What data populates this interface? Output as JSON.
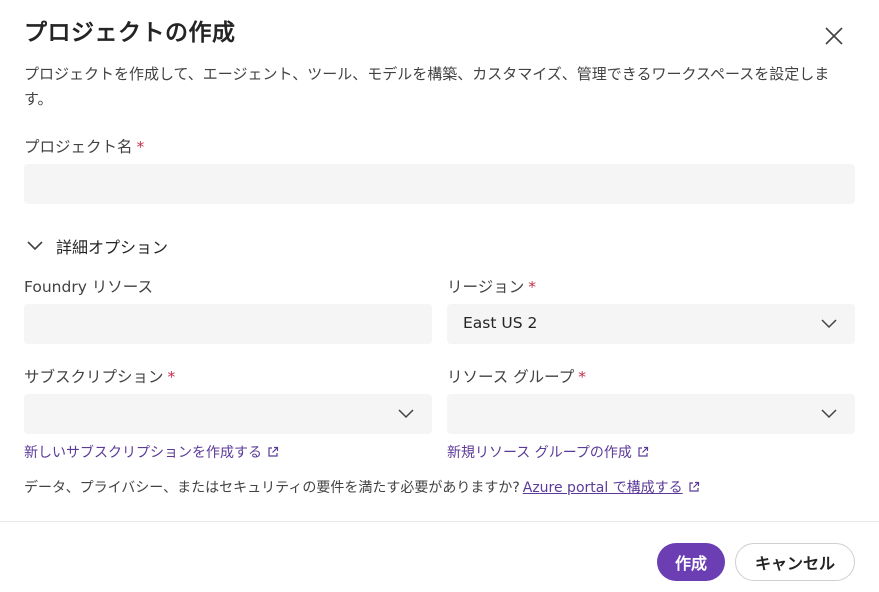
{
  "dialog": {
    "title": "プロジェクトの作成",
    "close_icon": "close-icon",
    "description": "プロジェクトを作成して、エージェント、ツール、モデルを構築、カスタマイズ、管理できるワークスペースを設定します。"
  },
  "project_name": {
    "label": "プロジェクト名",
    "required_mark": "*",
    "value": ""
  },
  "advanced": {
    "label": "詳細オプション",
    "icon": "chevron-down-icon"
  },
  "foundry_resource": {
    "label": "Foundry リソース",
    "value": ""
  },
  "region": {
    "label": "リージョン",
    "required_mark": "*",
    "selected": "East US 2"
  },
  "subscription": {
    "label": "サブスクリプション",
    "required_mark": "*",
    "selected": "",
    "link": "新しいサブスクリプションを作成する"
  },
  "resource_group": {
    "label": "リソース グループ",
    "required_mark": "*",
    "selected": "",
    "link": "新規リソース グループの作成"
  },
  "note": {
    "text": "データ、プライバシー、またはセキュリティの要件を満たす必要がありますか?",
    "link": "Azure portal で構成する"
  },
  "footer": {
    "create_label": "作成",
    "cancel_label": "キャンセル"
  },
  "colors": {
    "accent": "#6b3fb3",
    "link": "#5b3a99",
    "required": "#c4314b",
    "field_bg": "#f5f5f5"
  }
}
